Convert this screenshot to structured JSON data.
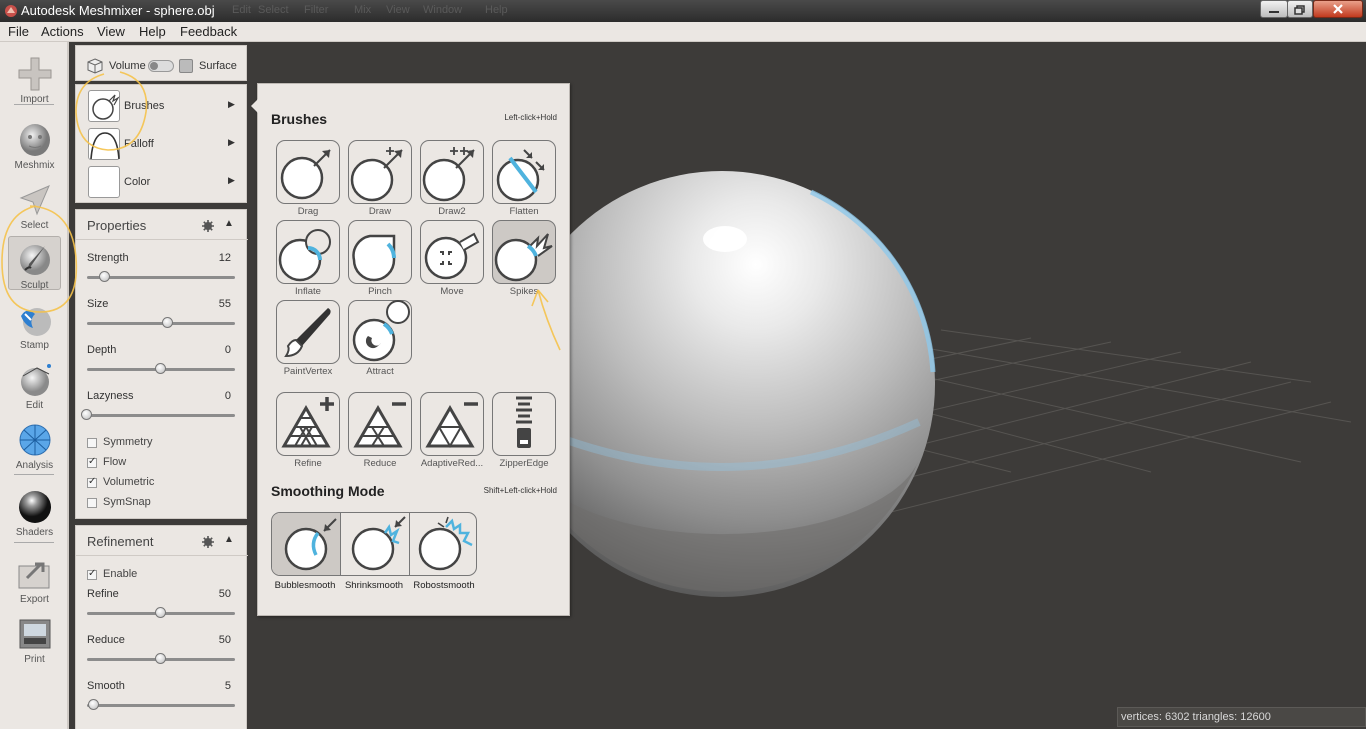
{
  "window": {
    "title": "Autodesk Meshmixer - sphere.obj",
    "ghost_menu": [
      "Edit",
      "Select",
      "Filter",
      "Mix",
      "View",
      "Window",
      "Help"
    ]
  },
  "menu": [
    "File",
    "Actions",
    "View",
    "Help",
    "Feedback"
  ],
  "tools": [
    {
      "label": "Import",
      "icon": "plus-icon"
    },
    {
      "label": "Meshmix",
      "icon": "meshmix-head-icon"
    },
    {
      "label": "Select",
      "icon": "select-arrow-icon"
    },
    {
      "label": "Sculpt",
      "icon": "sculpt-brush-icon",
      "active": true
    },
    {
      "label": "Stamp",
      "icon": "stamp-icon"
    },
    {
      "label": "Edit",
      "icon": "edit-sphere-icon"
    },
    {
      "label": "Analysis",
      "icon": "analysis-mesh-icon"
    },
    {
      "label": "Shaders",
      "icon": "shader-ball-icon"
    },
    {
      "label": "Export",
      "icon": "export-icon"
    },
    {
      "label": "Print",
      "icon": "printer-icon"
    }
  ],
  "mode_toggle": {
    "left": "Volume",
    "right": "Surface"
  },
  "brush_rows": [
    {
      "label": "Brushes"
    },
    {
      "label": "Falloff"
    },
    {
      "label": "Color"
    }
  ],
  "properties": {
    "title": "Properties",
    "sliders": [
      {
        "name": "Strength",
        "value": "12",
        "fraction": 0.12
      },
      {
        "name": "Size",
        "value": "55",
        "fraction": 0.55
      },
      {
        "name": "Depth",
        "value": "0",
        "fraction": 0.5
      },
      {
        "name": "Lazyness",
        "value": "0",
        "fraction": 0.0
      }
    ],
    "checkboxes": [
      {
        "name": "Symmetry",
        "checked": false
      },
      {
        "name": "Flow",
        "checked": true
      },
      {
        "name": "Volumetric",
        "checked": true
      },
      {
        "name": "SymSnap",
        "checked": false
      }
    ]
  },
  "refinement": {
    "title": "Refinement",
    "enable": {
      "name": "Enable",
      "checked": true
    },
    "sliders": [
      {
        "name": "Refine",
        "value": "50",
        "fraction": 0.5
      },
      {
        "name": "Reduce",
        "value": "50",
        "fraction": 0.5
      },
      {
        "name": "Smooth",
        "value": "5",
        "fraction": 0.05
      }
    ]
  },
  "brushes_popup": {
    "title": "Brushes",
    "hint": "Left-click+Hold",
    "brushes": [
      "Drag",
      "Draw",
      "Draw2",
      "Flatten",
      "Inflate",
      "Pinch",
      "Move",
      "Spikes",
      "PaintVertex",
      "Attract"
    ],
    "selected": "Spikes",
    "tools": [
      "Refine",
      "Reduce",
      "AdaptiveRed...",
      "ZipperEdge"
    ],
    "smoothing_title": "Smoothing Mode",
    "smoothing_hint": "Shift+Left-click+Hold",
    "smoothing": [
      "Bubblesmooth",
      "Shrinksmooth",
      "Robostsmooth"
    ],
    "smoothing_selected": "Bubblesmooth",
    "accent_color": "#4fb3de"
  },
  "status": {
    "text": "vertices: 6302 triangles: 12600"
  }
}
